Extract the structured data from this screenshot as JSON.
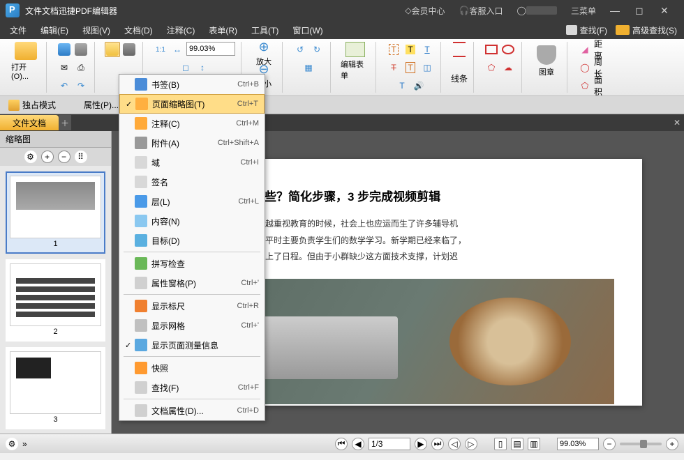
{
  "titlebar": {
    "title": "文件文档迅捷PDF编辑器",
    "member": "会员中心",
    "support": "客服入口",
    "menu": "菜单"
  },
  "menu": {
    "file": "文件",
    "edit": "编辑(E)",
    "view": "视图(V)",
    "document": "文档(D)",
    "comment": "注释(C)",
    "form": "表单(R)",
    "tool": "工具(T)",
    "window": "窗口(W)",
    "find": "查找(F)",
    "advfind": "高级查找(S)"
  },
  "ribbon": {
    "open": "打开(O)...",
    "zoom": "99.03%",
    "zoom_in": "放大",
    "zoom_out": "缩小",
    "edit_form": "编辑表单",
    "lines": "线条",
    "graphics": "图章",
    "distance": "距离",
    "perimeter": "周长",
    "area": "面积"
  },
  "sectb": {
    "exclusive": "独占模式",
    "props": "属性(P)..."
  },
  "tab": {
    "label": "文件文档"
  },
  "sidebar": {
    "title": "缩略图",
    "pages": [
      "1",
      "2",
      "3"
    ]
  },
  "ctx": {
    "bookmark": "书签(B)",
    "bookmark_sc": "Ctrl+B",
    "thumb": "页面缩略图(T)",
    "thumb_sc": "Ctrl+T",
    "comment": "注释(C)",
    "comment_sc": "Ctrl+M",
    "attach": "附件(A)",
    "attach_sc": "Ctrl+Shift+A",
    "field": "域",
    "field_sc": "Ctrl+I",
    "sign": "签名",
    "layer": "层(L)",
    "layer_sc": "Ctrl+L",
    "content": "内容(N)",
    "target": "目标(D)",
    "spell": "拼写检查",
    "propwin": "属性窗格(P)",
    "propwin_sc": "Ctrl+'",
    "ruler": "显示标尺",
    "ruler_sc": "Ctrl+R",
    "grid": "显示网格",
    "grid_sc": "Ctrl+'",
    "measure": "显示页面测量信息",
    "snapshot": "快照",
    "search": "查找(F)",
    "search_sc": "Ctrl+F",
    "docprops": "文档属性(D)...",
    "docprops_sc": "Ctrl+D"
  },
  "doc": {
    "heading": "频制作方法有哪些？简化步骤，3 步完成视频剪辑",
    "p1_bold": "法有哪些？",
    "p1": "当人们越来越重视教育的时候，社会上也应运而生了许多辅导机",
    "p2": "是一名辅导机构老师，平时主要负责学生们的数学学习。新学期已经来临了，",
    "p3": "辑、制作计划也早被提上了日程。但由于小群缺少这方面技术支撑，计划迟"
  },
  "status": {
    "page": "1",
    "total": "3",
    "zoom": "99.03%"
  }
}
